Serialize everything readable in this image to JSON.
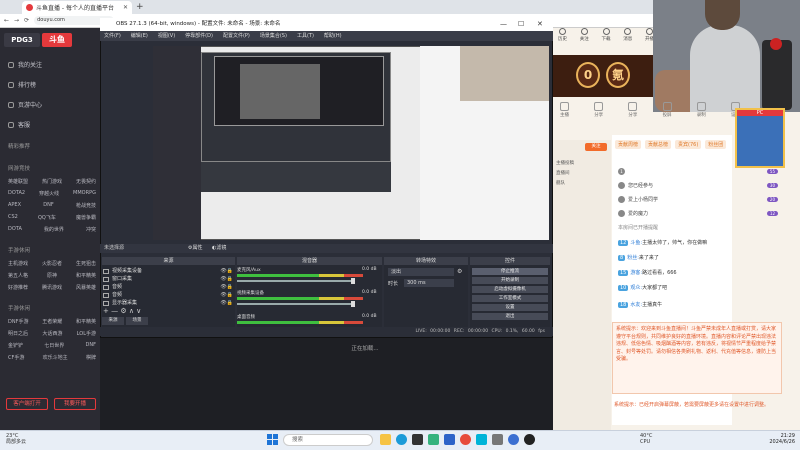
{
  "browser": {
    "tab_title": "斗鱼直播 - 每个人的直播平台",
    "url": "douyu.com"
  },
  "leftnav": {
    "logo_left": "PDG3",
    "logo_right": "斗鱼",
    "items": [
      "我的关注",
      "排行榜",
      "页游中心",
      "客服"
    ],
    "section_recommend": "精彩推荐",
    "section_games": "网游竞技",
    "grid_rows": [
      [
        "英雄联盟",
        "热门游戏",
        "无畏契约"
      ],
      [
        "DOTA2",
        "穿越火线",
        "MMORPG"
      ],
      [
        "APEX",
        "DNF",
        "枪战竞技"
      ],
      [
        "CS2",
        "QQ飞车",
        "魔兽争霸"
      ],
      [
        "DOTA",
        "我的世界",
        "冲突"
      ]
    ],
    "section_mobile": "手游休闲",
    "grid_rows2": [
      [
        "主机游戏",
        "火影忍者",
        "生死狙击"
      ],
      [
        "第五人格",
        "原神",
        "和平精英"
      ],
      [
        "好游推荐",
        "腾讯游戏",
        "风暴英雄"
      ]
    ],
    "section_entertain": "手游休闲",
    "grid_rows3": [
      [
        "DNF手游",
        "王者荣耀",
        "和平精英"
      ],
      [
        "明日之后",
        "大话西游",
        "LOL手游"
      ],
      [
        "金铲铲",
        "七日世界",
        "DNF"
      ],
      [
        "CF手游",
        "欢乐斗地主",
        "棋牌"
      ]
    ],
    "btn_left": "客户端打开",
    "btn_right": "我要开播"
  },
  "obs": {
    "title": "OBS 27.1.3 (64-bit, windows) - 配置文件: 未命名 - 场景: 未命名",
    "menu": [
      "文件(F)",
      "编辑(E)",
      "视图(V)",
      "停靠部件(D)",
      "配置文件(P)",
      "场景集合(S)",
      "工具(T)",
      "帮助(H)"
    ],
    "scene_label": "未选择源",
    "scene_btn_props": "属性",
    "scene_btn_filter": "滤镜",
    "docks": {
      "scenes": "来源",
      "mixer": "混音器",
      "transitions": "转场特效",
      "controls": "控件"
    },
    "sources": [
      "窗口采集",
      "音频",
      "音频",
      "显示器采集"
    ],
    "sources_label": "视频采集设备",
    "mixer": [
      {
        "name": "麦克风/Aux",
        "db": "0.0 dB"
      },
      {
        "name": "视频采集设备",
        "db": "0.0 dB"
      },
      {
        "name": "桌面音频",
        "db": "0.0 dB"
      }
    ],
    "transition": "淡出",
    "duration_label": "时长",
    "duration_value": "300 ms",
    "controls": [
      "停止推流",
      "开始录制",
      "启动虚拟摄像机",
      "工作室模式",
      "设置",
      "退出"
    ],
    "tab_scenes": "来源",
    "tab_filters": "场景",
    "status": "LIVE: 00:00:00  REC: 00:00:00  CPU: 0.1%, 60.00 fps",
    "loading": "正在加载..."
  },
  "right": {
    "top_icons": [
      "历史",
      "关注",
      "下载",
      "消息",
      "开播"
    ],
    "banner_chars": [
      "0",
      "氪"
    ],
    "row_icons": [
      "主播",
      "分享",
      "分享",
      "投屏",
      "录制",
      "设置"
    ],
    "follow_btn": "关注",
    "anchor_lines": [
      "主播投稿",
      "直播间",
      "舰队"
    ],
    "chat_tabs": [
      "贡献周榜",
      "贡献总榜",
      "贵宾(76)",
      "粉丝团"
    ],
    "rank_rows": [
      {
        "num": "1",
        "name": "",
        "lv": "55"
      },
      {
        "name": "您已经参与",
        "lv": "30"
      },
      {
        "name": "爱上小杨同学",
        "lv": "20"
      },
      {
        "name": "爱的魔力",
        "lv": "12"
      }
    ],
    "rank_note": "本房间已开播提醒",
    "chat_lines": [
      {
        "lv": "12",
        "name": "斗鱼:",
        "text": "主播太帅了，帅气，你在做嘛"
      },
      {
        "lv": "8",
        "name": "粉丝:",
        "text": "来了来了"
      },
      {
        "lv": "15",
        "name": "游客:",
        "text": "路过看看，666"
      },
      {
        "lv": "10",
        "name": "观众:",
        "text": "大家都了吧"
      },
      {
        "lv": "18",
        "name": "水友:",
        "text": "主播真牛"
      }
    ],
    "notice": "系统提示：欢迎来到斗鱼直播间！斗鱼严禁未成年人直播或打赏，请大家遵守平台规则，共同维护良好的直播环境。直播内容和评论严禁出现违法违规、低俗色情、吸烟酗酒等内容，若有违反，将视情节严重程度给予禁言、封号等处罚。请勿相信各类刷礼物、返利、代充值等信息，谨防上当受骗。",
    "notice2": "系统提示：已经开启弹幕屏蔽，若需要屏蔽更多请在设置中进行调整。"
  },
  "taskbar": {
    "weather_temp": "23°C",
    "weather_text": "局部多云",
    "search": "搜索",
    "tray_temp": "40°C",
    "tray_label": "CPU",
    "time": "21:29",
    "date": "2024/6/26"
  },
  "colors": {
    "accent": "#e4393c",
    "obs_bg": "#2b2e38",
    "douyu_orange": "#f26b2a"
  }
}
